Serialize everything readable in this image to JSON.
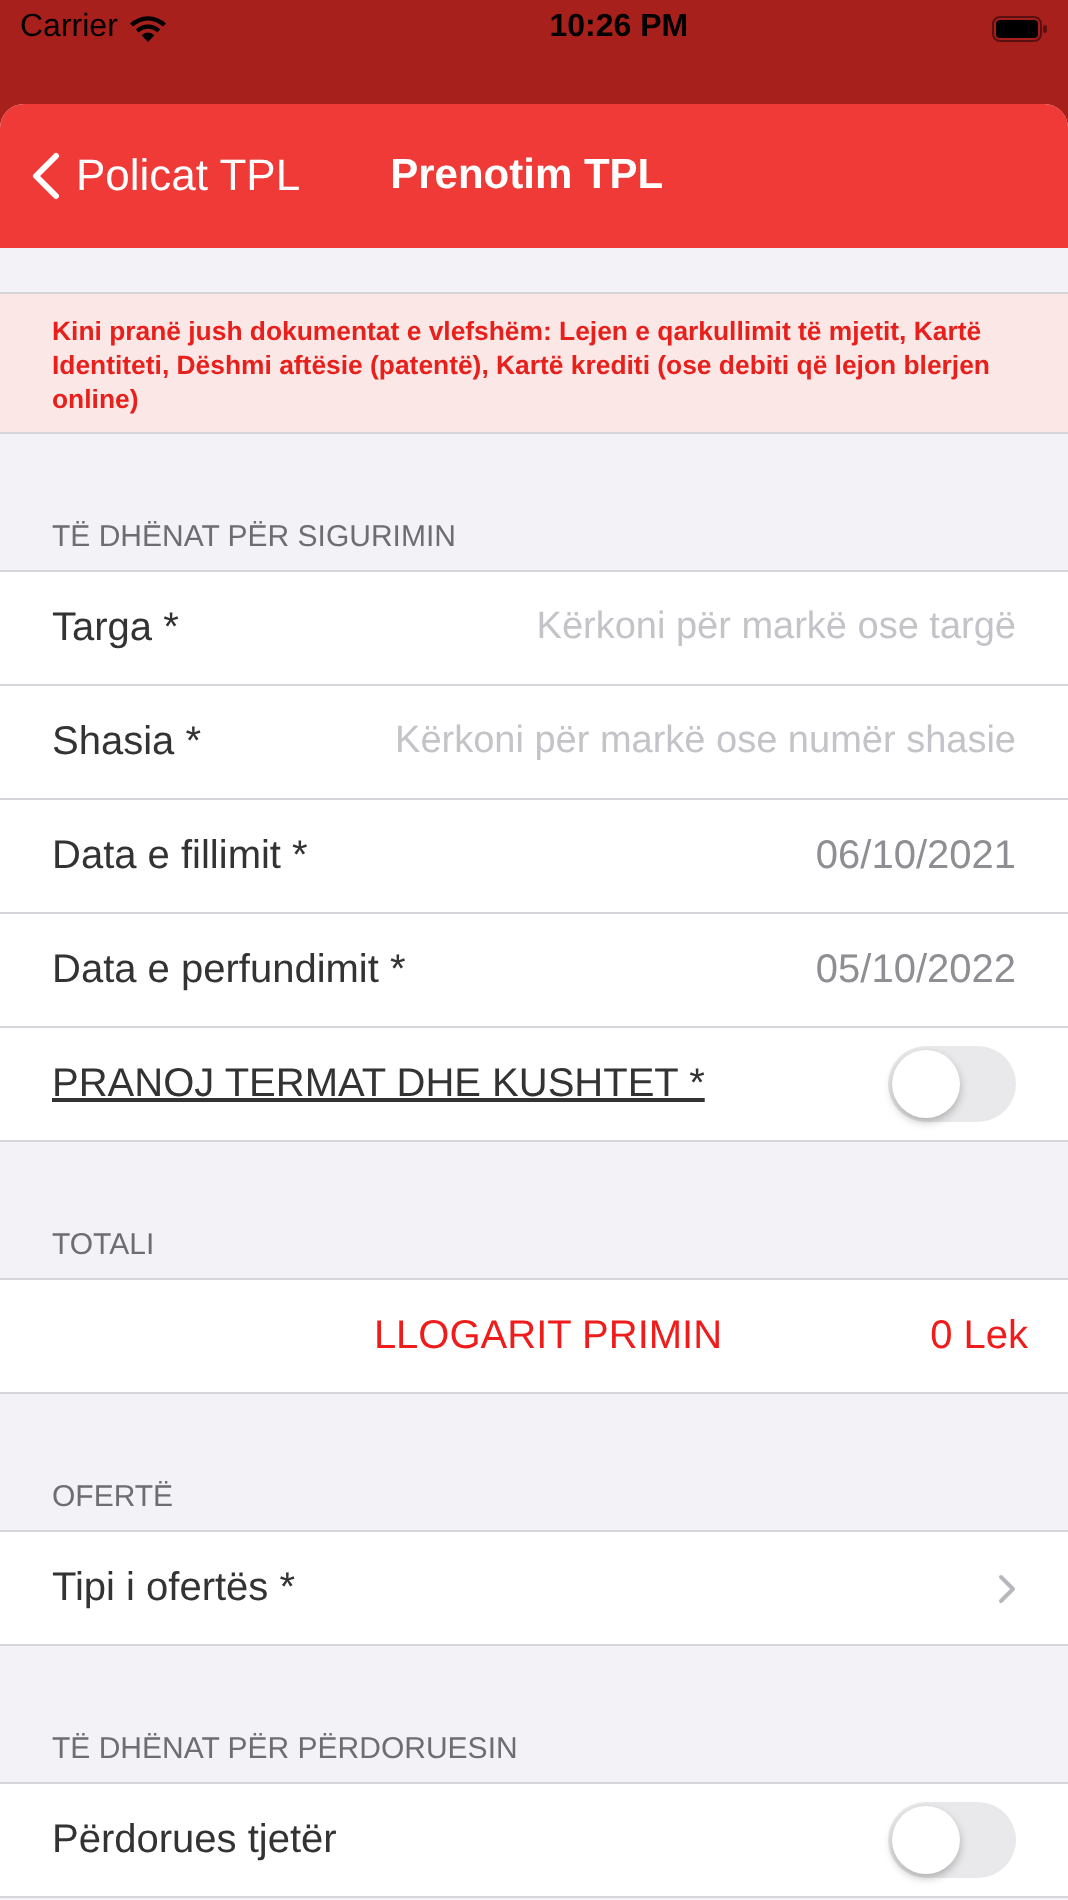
{
  "status_bar": {
    "carrier": "Carrier",
    "time": "10:26 PM"
  },
  "nav": {
    "back": "Policat TPL",
    "title": "Prenotim TPL"
  },
  "notice": "Kini pranë jush dokumentat e vlefshëm: Lejen e qarkullimit të mjetit, Kartë Identiteti, Dëshmi aftësie (patentë), Kartë krediti (ose debiti që lejon blerjen online)",
  "sections": [
    {
      "header": "TË DHËNAT PËR SIGURIMIN",
      "rows": [
        {
          "kind": "field",
          "label": "Targa *",
          "placeholder": "Kërkoni për markë ose targë"
        },
        {
          "kind": "field",
          "label": "Shasia *",
          "placeholder": "Kërkoni për markë ose numër shasie"
        },
        {
          "kind": "value",
          "label": "Data e fillimit *",
          "value": "06/10/2021"
        },
        {
          "kind": "value",
          "label": "Data e perfundimit *",
          "value": "05/10/2022"
        },
        {
          "kind": "agreement",
          "label": "PRANOJ TERMAT DHE KUSHTET *",
          "on": false
        }
      ]
    },
    {
      "header": "TOTALI",
      "rows": [
        {
          "kind": "action",
          "label": "LLOGARIT PRIMIN",
          "value": "0 Lek"
        }
      ]
    },
    {
      "header": "OFERTË",
      "rows": [
        {
          "kind": "disclosure",
          "label": "Tipi i ofertës *"
        }
      ]
    },
    {
      "header": "TË DHËNAT PËR PËRDORUESIN",
      "rows": [
        {
          "kind": "toggle",
          "label": "Përdorues tjetër",
          "on": false
        }
      ]
    }
  ]
}
